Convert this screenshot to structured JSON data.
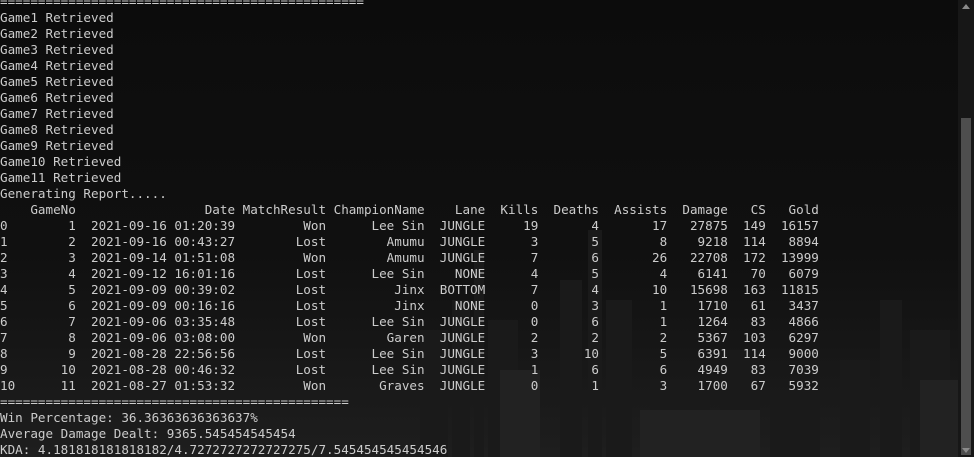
{
  "console": {
    "separator_top": "================================================",
    "retrieved": [
      "Game1 Retrieved",
      "Game2 Retrieved",
      "Game3 Retrieved",
      "Game4 Retrieved",
      "Game5 Retrieved",
      "Game6 Retrieved",
      "Game7 Retrieved",
      "Game8 Retrieved",
      "Game9 Retrieved",
      "Game10 Retrieved",
      "Game11 Retrieved"
    ],
    "generating": "Generating Report.....",
    "table_header": "    GameNo                 Date MatchResult ChampionName    Lane  Kills  Deaths  Assists  Damage   CS   Gold",
    "table_rows": [
      "0        1  2021-09-16 01:20:39         Won      Lee Sin  JUNGLE     19       4       17   27875  149  16157",
      "1        2  2021-09-16 00:43:27        Lost        Amumu  JUNGLE      3       5        8    9218  114   8894",
      "2        3  2021-09-14 01:51:08         Won        Amumu  JUNGLE      7       6       26   22708  172  13999",
      "3        4  2021-09-12 16:01:16        Lost      Lee Sin    NONE      4       5        4    6141   70   6079",
      "4        5  2021-09-09 00:39:02        Lost         Jinx  BOTTOM      7       4       10   15698  163  11815",
      "5        6  2021-09-09 00:16:16        Lost         Jinx    NONE      0       3        1    1710   61   3437",
      "6        7  2021-09-06 03:35:48        Lost      Lee Sin  JUNGLE      0       6        1    1264   83   4866",
      "7        8  2021-09-06 03:08:00         Won        Garen  JUNGLE      2       2        2    5367  103   6297",
      "8        9  2021-08-28 22:56:56        Lost      Lee Sin  JUNGLE      3      10        5    6391  114   9000",
      "9       10  2021-08-28 00:46:32        Lost      Lee Sin  JUNGLE      1       6        6    4949   83   7039",
      "10      11  2021-08-27 01:53:32         Won       Graves  JUNGLE      0       1        3    1700   67   5932"
    ],
    "separator_bottom": "==============================================",
    "win_percentage": "Win Percentage: 36.36363636363637%",
    "average_damage": "Average Damage Dealt: 9365.545454545454",
    "kda": "KDA: 4.181818181818182/4.7272727272727275/7.545454545454546"
  },
  "colors": {
    "background": "#0c0c0c",
    "text": "#cccccc",
    "scrollbar_track": "#171717",
    "scrollbar_thumb": "#4e4e4e"
  }
}
